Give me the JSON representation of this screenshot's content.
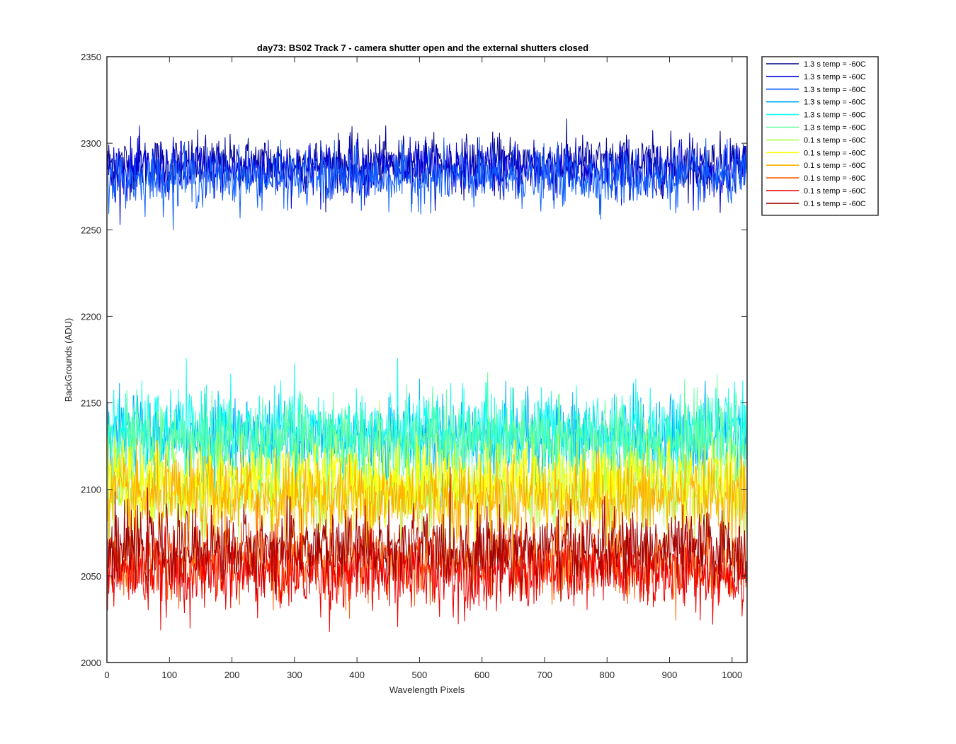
{
  "chart_data": {
    "type": "line",
    "title": "day73: BS02  Track 7 - camera shutter open and the external shutters closed",
    "xlabel": "Wavelength Pixels",
    "ylabel": "BackGrounds (ADU)",
    "xlim": [
      0,
      1024
    ],
    "ylim": [
      2000,
      2350
    ],
    "xticks": [
      0,
      100,
      200,
      300,
      400,
      500,
      600,
      700,
      800,
      900,
      1000
    ],
    "yticks": [
      2000,
      2050,
      2100,
      2150,
      2200,
      2250,
      2300,
      2350
    ],
    "n_points": 1024,
    "grid": false,
    "legend_position": "outside-top-right",
    "series": [
      {
        "name": "1.3 s temp = -60C",
        "color": "#00008F",
        "mean": 2288,
        "noise": 8
      },
      {
        "name": "1.3 s temp = -60C",
        "color": "#0000DF",
        "mean": 2285,
        "noise": 8
      },
      {
        "name": "1.3 s temp = -60C",
        "color": "#0F5FFF",
        "mean": 2280,
        "noise": 8
      },
      {
        "name": "1.3 s temp = -60C",
        "color": "#00AFFF",
        "mean": 2130,
        "noise": 12
      },
      {
        "name": "1.3 s temp = -60C",
        "color": "#0FFFEF",
        "mean": 2133,
        "noise": 12
      },
      {
        "name": "1.3 s temp = -60C",
        "color": "#5FFFA0",
        "mean": 2128,
        "noise": 12
      },
      {
        "name": "0.1 s temp = -60C",
        "color": "#AFFF50",
        "mean": 2100,
        "noise": 12
      },
      {
        "name": "0.1 s temp = -60C",
        "color": "#FFFF00",
        "mean": 2104,
        "noise": 12
      },
      {
        "name": "0.1 s temp = -60C",
        "color": "#FFAF00",
        "mean": 2095,
        "noise": 12
      },
      {
        "name": "0.1 s temp = -60C",
        "color": "#FF6000",
        "mean": 2058,
        "noise": 11
      },
      {
        "name": "0.1 s temp = -60C",
        "color": "#EF0000",
        "mean": 2052,
        "noise": 11
      },
      {
        "name": "0.1 s temp = -60C",
        "color": "#9F0000",
        "mean": 2066,
        "noise": 11
      }
    ]
  }
}
